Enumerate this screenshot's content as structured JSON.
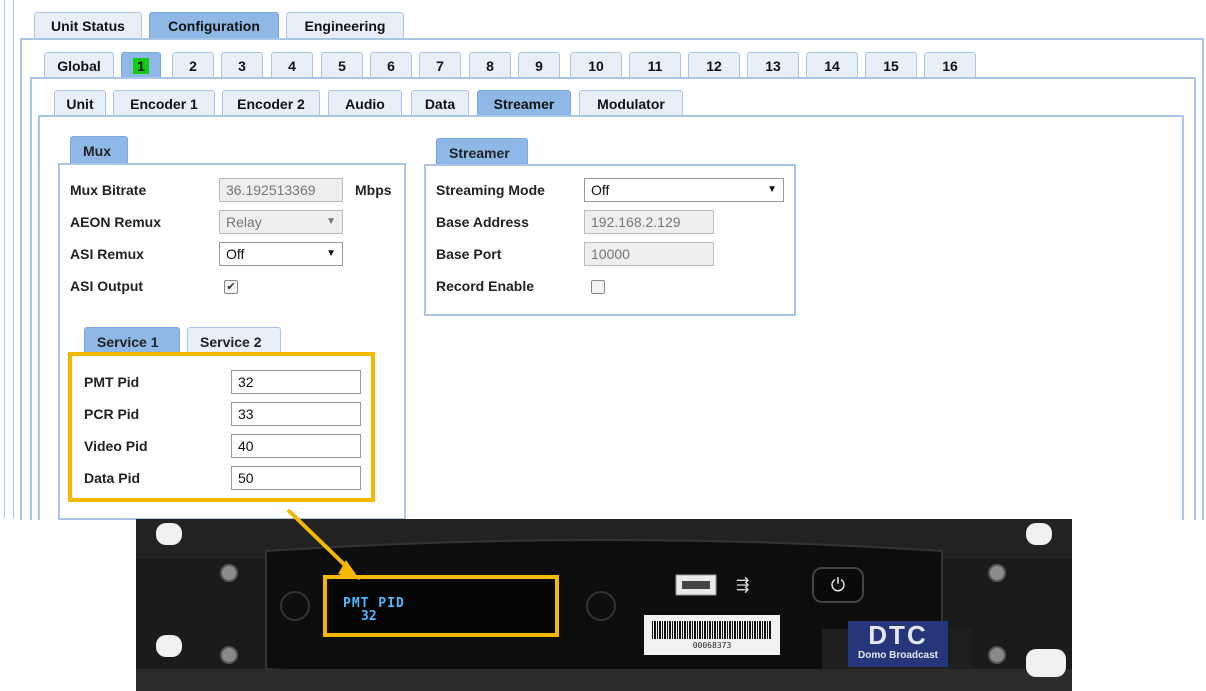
{
  "top_tabs": [
    "Unit Status",
    "Configuration",
    "Engineering"
  ],
  "channel_tabs": [
    "Global",
    "1",
    "2",
    "3",
    "4",
    "5",
    "6",
    "7",
    "8",
    "9",
    "10",
    "11",
    "12",
    "13",
    "14",
    "15",
    "16"
  ],
  "sub_tabs": [
    "Unit",
    "Encoder 1",
    "Encoder 2",
    "Audio",
    "Data",
    "Streamer",
    "Modulator"
  ],
  "mux": {
    "title": "Mux",
    "rows": [
      {
        "label": "Mux Bitrate",
        "value": "36.192513369",
        "unit": "Mbps"
      },
      {
        "label": "AEON Remux",
        "value": "Relay"
      },
      {
        "label": "ASI Remux",
        "value": "Off"
      },
      {
        "label": "ASI Output",
        "checked": true
      }
    ],
    "service_tabs": [
      "Service 1",
      "Service 2"
    ],
    "service_rows": [
      {
        "label": "PMT Pid",
        "value": "32"
      },
      {
        "label": "PCR Pid",
        "value": "33"
      },
      {
        "label": "Video Pid",
        "value": "40"
      },
      {
        "label": "Data Pid",
        "value": "50"
      }
    ]
  },
  "streamer": {
    "title": "Streamer",
    "rows": [
      {
        "label": "Streaming Mode",
        "value": "Off"
      },
      {
        "label": "Base Address",
        "value": "192.168.2.129"
      },
      {
        "label": "Base Port",
        "value": "10000"
      },
      {
        "label": "Record Enable",
        "checked": false
      }
    ]
  },
  "device": {
    "display_line1": "PMT PID",
    "display_line2": "32",
    "barcode_number": "00068373",
    "logo": "DTC",
    "brand": "Domo Broadcast",
    "icons": [
      "usb-port-icon",
      "usb-symbol-icon",
      "power-button-icon"
    ]
  },
  "colors": {
    "tab_active": "#8fb8e6",
    "tab_inactive": "#e9eff7",
    "border": "#a9c6e8",
    "highlight": "#f5b800",
    "channel_selected": "#11cc11",
    "display_text": "#4fb8ff"
  }
}
